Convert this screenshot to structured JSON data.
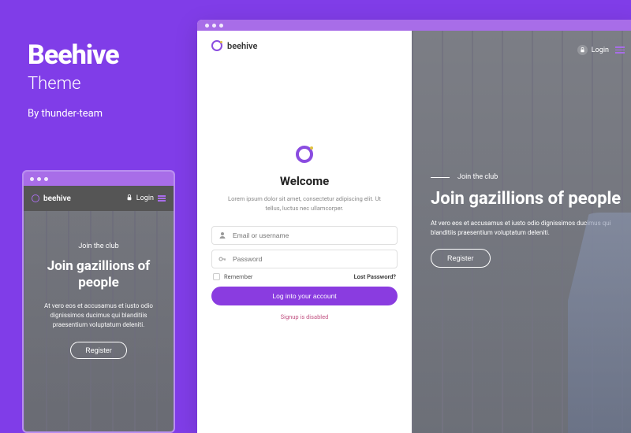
{
  "info": {
    "title": "Beehive",
    "subtitle": "Theme",
    "author": "By thunder-team"
  },
  "brand": {
    "name": "beehive"
  },
  "mobile": {
    "login_label": "Login",
    "eyebrow": "Join the club",
    "heading": "Join gazillions of people",
    "copy": "At vero eos et accusamus et iusto odio dignissimos ducimus qui blanditiis praesentium voluptatum deleniti.",
    "register_label": "Register"
  },
  "desktop": {
    "welcome_title": "Welcome",
    "welcome_copy": "Lorem ipsum dolor sit amet, consectetur adipiscing elit. Ut tellus, luctus nec ullamcorper.",
    "email_placeholder": "Email or username",
    "password_placeholder": "Password",
    "remember_label": "Remember",
    "lost_password_label": "Lost Password?",
    "login_button_label": "Log into your account",
    "signup_disabled_label": "Signup is disabled",
    "header_login_label": "Login",
    "hero_eyebrow": "Join the club",
    "hero_heading": "Join gazillions of people",
    "hero_copy": "At vero eos et accusamus et iusto odio dignissimos ducimus qui blanditiis praesentium voluptatum deleniti.",
    "hero_register_label": "Register"
  },
  "colors": {
    "background": "#803de8",
    "accent": "#8a3ce0",
    "titlebar": "#a86de8"
  }
}
